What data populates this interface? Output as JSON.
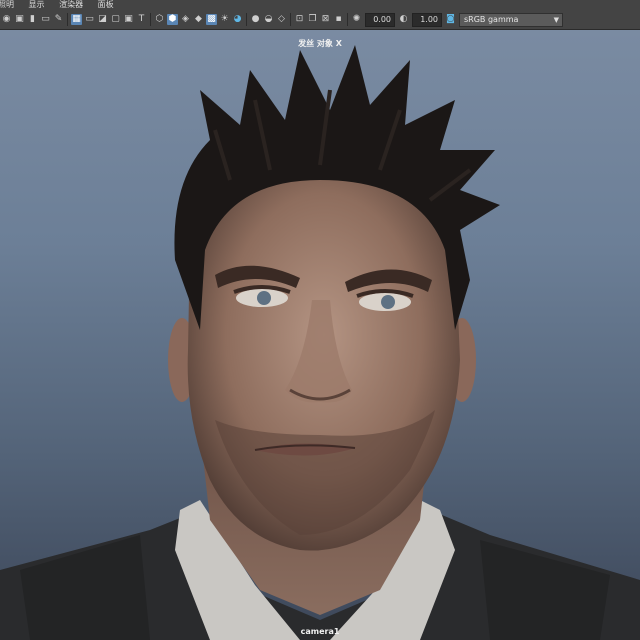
{
  "menubar": {
    "items": [
      "照明",
      "显示",
      "渲染器",
      "面板"
    ]
  },
  "toolbar": {
    "icons": [
      "camera-select-icon",
      "camera-lock-icon",
      "bookmark-icon",
      "image-plane-icon",
      "grid-icon",
      "film-gate-icon",
      "resolution-gate-icon",
      "gate-mask-icon",
      "safe-action-icon",
      "wireframe-icon",
      "smooth-shade-icon",
      "shaded-wire-icon",
      "textured-icon",
      "lights-icon",
      "shadows-icon",
      "ambient-occlusion-icon",
      "motion-blur-icon",
      "multisample-icon",
      "isolate-icon",
      "xray-icon",
      "xray-joints-icon",
      "backface-icon"
    ],
    "exposure_value": "0.00",
    "gamma_value": "1.00",
    "color_space": "sRGB gamma"
  },
  "viewport": {
    "hud_top": "发丝 对象 X",
    "camera_label": "camera1"
  },
  "colors": {
    "viewport_top": "#7a8ba2",
    "viewport_bottom": "#3c4658",
    "toolbar_bg": "#444444",
    "active_icon": "#5a86b5"
  }
}
